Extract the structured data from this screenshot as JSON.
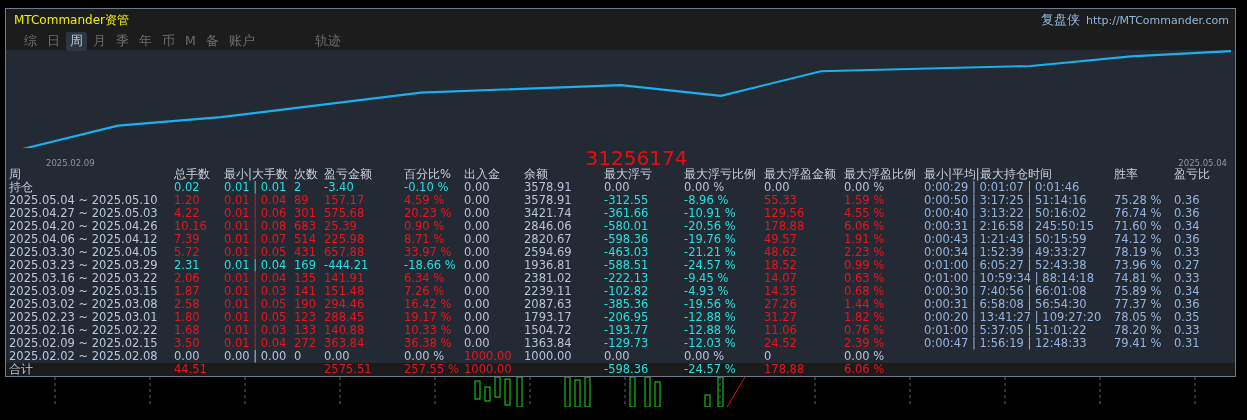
{
  "window": {
    "title": "MTCommander资管",
    "brand": "复盘侠",
    "url": "http://MTCommander.com"
  },
  "tabs": [
    {
      "label": "综",
      "selected": false
    },
    {
      "label": "日",
      "selected": false
    },
    {
      "label": "周",
      "selected": true
    },
    {
      "label": "月",
      "selected": false
    },
    {
      "label": "季",
      "selected": false
    },
    {
      "label": "年",
      "selected": false
    },
    {
      "label": "币",
      "selected": false
    },
    {
      "label": "M",
      "selected": false
    },
    {
      "label": "备",
      "selected": false
    },
    {
      "label": "账户",
      "selected": false
    }
  ],
  "trace_tab": {
    "label": "轨迹",
    "selected": false
  },
  "equity_chart": {
    "start_label": "2025.02.09",
    "end_label": "2025.05.04",
    "center_number": "31256174"
  },
  "table": {
    "columns": [
      "周",
      "总手数",
      "最小|大手数",
      "次数",
      "盈亏金额",
      "百分比%",
      "出入金",
      "余额",
      "最大浮亏",
      "最大浮亏比例",
      "最大浮盈金额",
      "最大浮盈比例",
      "最小|平均|最大持仓时间",
      "胜率",
      "盈亏比"
    ],
    "rows": [
      {
        "cells": [
          {
            "text": "持仓",
            "kind": "label"
          },
          {
            "text": "0.02",
            "kind": "loss"
          },
          {
            "text": "0.01 | 0.01",
            "kind": "loss"
          },
          {
            "text": "2",
            "kind": "loss"
          },
          {
            "text": "-3.40",
            "kind": "loss"
          },
          {
            "text": "-0.10 %",
            "kind": "loss"
          },
          {
            "text": "0.00",
            "kind": "zero"
          },
          {
            "text": "3578.91",
            "kind": "zero"
          },
          {
            "text": "0.00",
            "kind": "zero"
          },
          {
            "text": "0.00 %",
            "kind": "zero"
          },
          {
            "text": "0.00",
            "kind": "zero"
          },
          {
            "text": "0.00 %",
            "kind": "zero"
          },
          {
            "text": "0:00:29 | 0:01:07 | 0:01:46",
            "kind": "time"
          }
        ]
      },
      {
        "cells": [
          {
            "text": "2025.05.04 ~ 2025.05.10",
            "kind": "label"
          },
          {
            "text": "1.20",
            "kind": "profit"
          },
          {
            "text": "0.01 | 0.04",
            "kind": "profit"
          },
          {
            "text": "89",
            "kind": "profit"
          },
          {
            "text": "157.17",
            "kind": "profit"
          },
          {
            "text": "4.59 %",
            "kind": "profit"
          },
          {
            "text": "0.00",
            "kind": "zero"
          },
          {
            "text": "3578.91",
            "kind": "zero"
          },
          {
            "text": "-312.55",
            "kind": "loss"
          },
          {
            "text": "-8.96 %",
            "kind": "loss"
          },
          {
            "text": "55.33",
            "kind": "profit"
          },
          {
            "text": "1.59 %",
            "kind": "profit"
          },
          {
            "text": "0:00:50 | 3:17:25 | 51:14:16",
            "kind": "time"
          },
          {
            "text": "75.28 %",
            "kind": "time"
          },
          {
            "text": "0.36",
            "kind": "time"
          }
        ]
      },
      {
        "cells": [
          {
            "text": "2025.04.27 ~ 2025.05.03",
            "kind": "label"
          },
          {
            "text": "4.22",
            "kind": "profit"
          },
          {
            "text": "0.01 | 0.06",
            "kind": "profit"
          },
          {
            "text": "301",
            "kind": "profit"
          },
          {
            "text": "575.68",
            "kind": "profit"
          },
          {
            "text": "20.23 %",
            "kind": "profit"
          },
          {
            "text": "0.00",
            "kind": "zero"
          },
          {
            "text": "3421.74",
            "kind": "zero"
          },
          {
            "text": "-361.66",
            "kind": "loss"
          },
          {
            "text": "-10.91 %",
            "kind": "loss"
          },
          {
            "text": "129.56",
            "kind": "profit"
          },
          {
            "text": "4.55 %",
            "kind": "profit"
          },
          {
            "text": "0:00:40 | 3:13:22 | 50:16:02",
            "kind": "time"
          },
          {
            "text": "76.74 %",
            "kind": "time"
          },
          {
            "text": "0.36",
            "kind": "time"
          }
        ]
      },
      {
        "cells": [
          {
            "text": "2025.04.20 ~ 2025.04.26",
            "kind": "label"
          },
          {
            "text": "10.16",
            "kind": "profit"
          },
          {
            "text": "0.01 | 0.08",
            "kind": "profit"
          },
          {
            "text": "683",
            "kind": "profit"
          },
          {
            "text": "25.39",
            "kind": "profit"
          },
          {
            "text": "0.90 %",
            "kind": "profit"
          },
          {
            "text": "0.00",
            "kind": "zero"
          },
          {
            "text": "2846.06",
            "kind": "zero"
          },
          {
            "text": "-580.01",
            "kind": "loss"
          },
          {
            "text": "-20.56 %",
            "kind": "loss"
          },
          {
            "text": "178.88",
            "kind": "profit"
          },
          {
            "text": "6.06 %",
            "kind": "profit"
          },
          {
            "text": "0:00:31 | 2:16:58 | 245:50:15",
            "kind": "time"
          },
          {
            "text": "71.60 %",
            "kind": "time"
          },
          {
            "text": "0.34",
            "kind": "time"
          }
        ]
      },
      {
        "cells": [
          {
            "text": "2025.04.06 ~ 2025.04.12",
            "kind": "label"
          },
          {
            "text": "7.39",
            "kind": "profit"
          },
          {
            "text": "0.01 | 0.07",
            "kind": "profit"
          },
          {
            "text": "514",
            "kind": "profit"
          },
          {
            "text": "225.98",
            "kind": "profit"
          },
          {
            "text": "8.71 %",
            "kind": "profit"
          },
          {
            "text": "0.00",
            "kind": "zero"
          },
          {
            "text": "2820.67",
            "kind": "zero"
          },
          {
            "text": "-598.36",
            "kind": "loss"
          },
          {
            "text": "-19.76 %",
            "kind": "loss"
          },
          {
            "text": "49.57",
            "kind": "profit"
          },
          {
            "text": "1.91 %",
            "kind": "profit"
          },
          {
            "text": "0:00:43 | 1:21:43 | 50:15:59",
            "kind": "time"
          },
          {
            "text": "74.12 %",
            "kind": "time"
          },
          {
            "text": "0.36",
            "kind": "time"
          }
        ]
      },
      {
        "cells": [
          {
            "text": "2025.03.30 ~ 2025.04.05",
            "kind": "label"
          },
          {
            "text": "5.72",
            "kind": "profit"
          },
          {
            "text": "0.01 | 0.05",
            "kind": "profit"
          },
          {
            "text": "431",
            "kind": "profit"
          },
          {
            "text": "657.88",
            "kind": "profit"
          },
          {
            "text": "33.97 %",
            "kind": "profit"
          },
          {
            "text": "0.00",
            "kind": "zero"
          },
          {
            "text": "2594.69",
            "kind": "zero"
          },
          {
            "text": "-463.03",
            "kind": "loss"
          },
          {
            "text": "-21.21 %",
            "kind": "loss"
          },
          {
            "text": "48.62",
            "kind": "profit"
          },
          {
            "text": "2.23 %",
            "kind": "profit"
          },
          {
            "text": "0:00:34 | 1:52:39 | 49:33:27",
            "kind": "time"
          },
          {
            "text": "78.19 %",
            "kind": "time"
          },
          {
            "text": "0.33",
            "kind": "time"
          }
        ]
      },
      {
        "cells": [
          {
            "text": "2025.03.23 ~ 2025.03.29",
            "kind": "label"
          },
          {
            "text": "2.31",
            "kind": "loss"
          },
          {
            "text": "0.01 | 0.04",
            "kind": "loss"
          },
          {
            "text": "169",
            "kind": "loss"
          },
          {
            "text": "-444.21",
            "kind": "loss"
          },
          {
            "text": "-18.66 %",
            "kind": "loss"
          },
          {
            "text": "0.00",
            "kind": "zero"
          },
          {
            "text": "1936.81",
            "kind": "zero"
          },
          {
            "text": "-588.51",
            "kind": "loss"
          },
          {
            "text": "-24.57 %",
            "kind": "loss"
          },
          {
            "text": "18.52",
            "kind": "profit"
          },
          {
            "text": "0.99 %",
            "kind": "profit"
          },
          {
            "text": "0:01:00 | 6:05:27 | 52:43:38",
            "kind": "time"
          },
          {
            "text": "73.96 %",
            "kind": "time"
          },
          {
            "text": "0.27",
            "kind": "time"
          }
        ]
      },
      {
        "cells": [
          {
            "text": "2025.03.16 ~ 2025.03.22",
            "kind": "label"
          },
          {
            "text": "2.06",
            "kind": "profit"
          },
          {
            "text": "0.01 | 0.04",
            "kind": "profit"
          },
          {
            "text": "135",
            "kind": "profit"
          },
          {
            "text": "141.91",
            "kind": "profit"
          },
          {
            "text": "6.34 %",
            "kind": "profit"
          },
          {
            "text": "0.00",
            "kind": "zero"
          },
          {
            "text": "2381.02",
            "kind": "zero"
          },
          {
            "text": "-222.13",
            "kind": "loss"
          },
          {
            "text": "-9.45 %",
            "kind": "loss"
          },
          {
            "text": "14.07",
            "kind": "profit"
          },
          {
            "text": "0.63 %",
            "kind": "profit"
          },
          {
            "text": "0:01:00 | 10:59:34 | 88:14:18",
            "kind": "time"
          },
          {
            "text": "74.81 %",
            "kind": "time"
          },
          {
            "text": "0.33",
            "kind": "time"
          }
        ]
      },
      {
        "cells": [
          {
            "text": "2025.03.09 ~ 2025.03.15",
            "kind": "label"
          },
          {
            "text": "1.87",
            "kind": "profit"
          },
          {
            "text": "0.01 | 0.03",
            "kind": "profit"
          },
          {
            "text": "141",
            "kind": "profit"
          },
          {
            "text": "151.48",
            "kind": "profit"
          },
          {
            "text": "7.26 %",
            "kind": "profit"
          },
          {
            "text": "0.00",
            "kind": "zero"
          },
          {
            "text": "2239.11",
            "kind": "zero"
          },
          {
            "text": "-102.82",
            "kind": "loss"
          },
          {
            "text": "-4.93 %",
            "kind": "loss"
          },
          {
            "text": "14.35",
            "kind": "profit"
          },
          {
            "text": "0.68 %",
            "kind": "profit"
          },
          {
            "text": "0:00:30 | 7:40:56 | 66:01:08",
            "kind": "time"
          },
          {
            "text": "75.89 %",
            "kind": "time"
          },
          {
            "text": "0.34",
            "kind": "time"
          }
        ]
      },
      {
        "cells": [
          {
            "text": "2025.03.02 ~ 2025.03.08",
            "kind": "label"
          },
          {
            "text": "2.58",
            "kind": "profit"
          },
          {
            "text": "0.01 | 0.05",
            "kind": "profit"
          },
          {
            "text": "190",
            "kind": "profit"
          },
          {
            "text": "294.46",
            "kind": "profit"
          },
          {
            "text": "16.42 %",
            "kind": "profit"
          },
          {
            "text": "0.00",
            "kind": "zero"
          },
          {
            "text": "2087.63",
            "kind": "zero"
          },
          {
            "text": "-385.36",
            "kind": "loss"
          },
          {
            "text": "-19.56 %",
            "kind": "loss"
          },
          {
            "text": "27.26",
            "kind": "profit"
          },
          {
            "text": "1.44 %",
            "kind": "profit"
          },
          {
            "text": "0:00:31 | 6:58:08 | 56:54:30",
            "kind": "time"
          },
          {
            "text": "77.37 %",
            "kind": "time"
          },
          {
            "text": "0.36",
            "kind": "time"
          }
        ]
      },
      {
        "cells": [
          {
            "text": "2025.02.23 ~ 2025.03.01",
            "kind": "label"
          },
          {
            "text": "1.80",
            "kind": "profit"
          },
          {
            "text": "0.01 | 0.05",
            "kind": "profit"
          },
          {
            "text": "123",
            "kind": "profit"
          },
          {
            "text": "288.45",
            "kind": "profit"
          },
          {
            "text": "19.17 %",
            "kind": "profit"
          },
          {
            "text": "0.00",
            "kind": "zero"
          },
          {
            "text": "1793.17",
            "kind": "zero"
          },
          {
            "text": "-206.95",
            "kind": "loss"
          },
          {
            "text": "-12.88 %",
            "kind": "loss"
          },
          {
            "text": "31.27",
            "kind": "profit"
          },
          {
            "text": "1.82 %",
            "kind": "profit"
          },
          {
            "text": "0:00:20 | 13:41:27 | 109:27:20",
            "kind": "time"
          },
          {
            "text": "78.05 %",
            "kind": "time"
          },
          {
            "text": "0.35",
            "kind": "time"
          }
        ]
      },
      {
        "cells": [
          {
            "text": "2025.02.16 ~ 2025.02.22",
            "kind": "label"
          },
          {
            "text": "1.68",
            "kind": "profit"
          },
          {
            "text": "0.01 | 0.03",
            "kind": "profit"
          },
          {
            "text": "133",
            "kind": "profit"
          },
          {
            "text": "140.88",
            "kind": "profit"
          },
          {
            "text": "10.33 %",
            "kind": "profit"
          },
          {
            "text": "0.00",
            "kind": "zero"
          },
          {
            "text": "1504.72",
            "kind": "zero"
          },
          {
            "text": "-193.77",
            "kind": "loss"
          },
          {
            "text": "-12.88 %",
            "kind": "loss"
          },
          {
            "text": "11.06",
            "kind": "profit"
          },
          {
            "text": "0.76 %",
            "kind": "profit"
          },
          {
            "text": "0:01:00 | 5:37:05 | 51:01:22",
            "kind": "time"
          },
          {
            "text": "78.20 %",
            "kind": "time"
          },
          {
            "text": "0.33",
            "kind": "time"
          }
        ]
      },
      {
        "cells": [
          {
            "text": "2025.02.09 ~ 2025.02.15",
            "kind": "label"
          },
          {
            "text": "3.50",
            "kind": "profit"
          },
          {
            "text": "0.01 | 0.04",
            "kind": "profit"
          },
          {
            "text": "272",
            "kind": "profit"
          },
          {
            "text": "363.84",
            "kind": "profit"
          },
          {
            "text": "36.38 %",
            "kind": "profit"
          },
          {
            "text": "0.00",
            "kind": "zero"
          },
          {
            "text": "1363.84",
            "kind": "zero"
          },
          {
            "text": "-129.73",
            "kind": "loss"
          },
          {
            "text": "-12.03 %",
            "kind": "loss"
          },
          {
            "text": "24.52",
            "kind": "profit"
          },
          {
            "text": "2.39 %",
            "kind": "profit"
          },
          {
            "text": "0:00:47 | 1:56:19 | 12:48:33",
            "kind": "time"
          },
          {
            "text": "79.41 %",
            "kind": "time"
          },
          {
            "text": "0.31",
            "kind": "time"
          }
        ]
      },
      {
        "cells": [
          {
            "text": "2025.02.02 ~ 2025.02.08",
            "kind": "label"
          },
          {
            "text": "0.00",
            "kind": "zero"
          },
          {
            "text": "0.00 | 0.00",
            "kind": "zero"
          },
          {
            "text": "0",
            "kind": "zero"
          },
          {
            "text": "0.00",
            "kind": "zero"
          },
          {
            "text": "0.00 %",
            "kind": "zero"
          },
          {
            "text": "1000.00",
            "kind": "profit"
          },
          {
            "text": "1000.00",
            "kind": "zero"
          },
          {
            "text": "0.00",
            "kind": "zero"
          },
          {
            "text": "0.00 %",
            "kind": "zero"
          },
          {
            "text": "0",
            "kind": "zero"
          },
          {
            "text": "0.00 %",
            "kind": "zero"
          }
        ]
      }
    ],
    "total": {
      "cells": [
        {
          "text": "合计",
          "kind": "label"
        },
        {
          "text": "44.51",
          "kind": "profit"
        },
        {
          "text": ""
        },
        {
          "text": ""
        },
        {
          "text": "2575.51",
          "kind": "profit"
        },
        {
          "text": "257.55 %",
          "kind": "profit"
        },
        {
          "text": "1000.00",
          "kind": "profit"
        },
        {
          "text": ""
        },
        {
          "text": "-598.36",
          "kind": "loss"
        },
        {
          "text": "-24.57 %",
          "kind": "loss"
        },
        {
          "text": "178.88",
          "kind": "profit"
        },
        {
          "text": "6.06 %",
          "kind": "profit"
        }
      ]
    }
  }
}
